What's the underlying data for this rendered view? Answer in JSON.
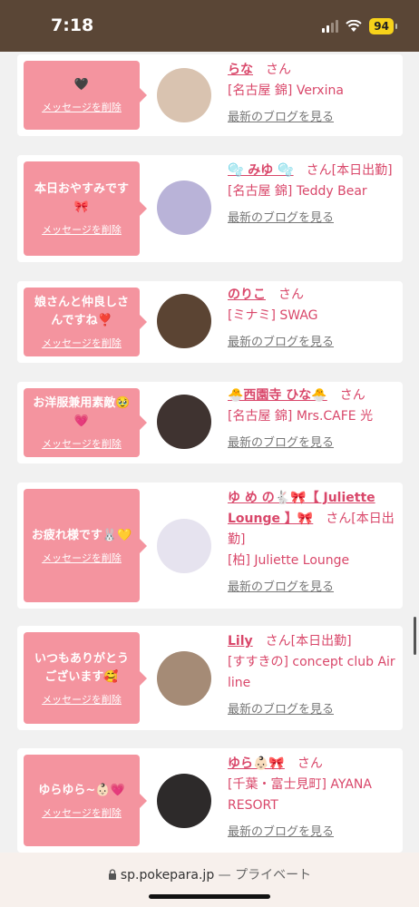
{
  "status_bar": {
    "time": "7:18",
    "battery": "94"
  },
  "cards": [
    {
      "message": "🖤",
      "delete_label": "メッセージを削除",
      "name": "らな",
      "suffix": "さん",
      "shop": "[名古屋 錦] Verxina",
      "blog_label": "最新のブログを見る",
      "avatar_color": "#d9c3b0"
    },
    {
      "message": "本日おやすみです🎀",
      "delete_label": "メッセージを削除",
      "name": "🫧 みゆ 🫧",
      "suffix": "さん[本日出勤]",
      "shop": "[名古屋 錦] Teddy Bear",
      "blog_label": "最新のブログを見る",
      "avatar_color": "#b9b3d8"
    },
    {
      "message": "娘さんと仲良しさんですね❣️",
      "delete_label": "メッセージを削除",
      "name": "のりこ",
      "suffix": "さん",
      "shop": "[ミナミ] SWAG",
      "blog_label": "最新のブログを見る",
      "avatar_color": "#5b4433"
    },
    {
      "message": "お洋服兼用素敵🥹💗",
      "delete_label": "メッセージを削除",
      "name": "🐣西園寺 ひな🐣",
      "suffix": "さん",
      "shop": "[名古屋 錦] Mrs.CAFE 光",
      "blog_label": "最新のブログを見る",
      "avatar_color": "#3f3330"
    },
    {
      "message": "お疲れ様です🐰💛",
      "delete_label": "メッセージを削除",
      "name": "ゆ め の🐇🎀【 Juliette Lounge 】🎀",
      "suffix": "さん[本日出勤]",
      "shop": "[柏] Juliette Lounge",
      "blog_label": "最新のブログを見る",
      "avatar_color": "#e6e3ef"
    },
    {
      "message": "いつもありがとうございます🥰",
      "delete_label": "メッセージを削除",
      "name": "Lily",
      "suffix": "さん[本日出勤]",
      "shop": "[すすきの] concept club Air line",
      "blog_label": "最新のブログを見る",
      "avatar_color": "#a58b76"
    },
    {
      "message": "ゆらゆら~👶🏻💗",
      "delete_label": "メッセージを削除",
      "name": "ゆら👶🏻🎀",
      "suffix": "さん",
      "shop": "[千葉・富士見町] AYANA RESORT",
      "blog_label": "最新のブログを見る",
      "avatar_color": "#2d2a2a"
    }
  ],
  "url_bar": {
    "domain": "sp.pokepara.jp",
    "mode": "— プライベート"
  },
  "colors": {
    "accent": "#d9476a",
    "bubble": "#f4949f",
    "status_bar": "#5a4636"
  }
}
